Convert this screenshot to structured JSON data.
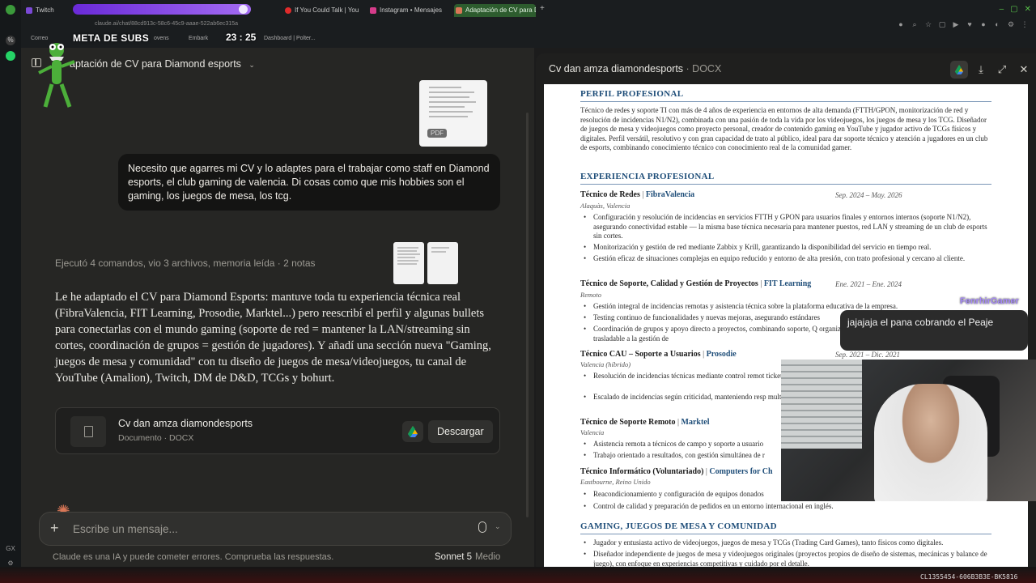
{
  "browser": {
    "tabs": [
      {
        "label": "Twitch"
      },
      {
        "label": "If You Could Talk | You"
      },
      {
        "label": "Instagram • Mensajes"
      },
      {
        "label": "Adaptación de CV para Dia"
      }
    ],
    "address": "claude.ai/chat/88cd913c-58c6-45c9-aaae-522ab6ec315a",
    "bookmarks": [
      "Correo",
      "ovens",
      "Embark",
      "Dashboard | Polter..."
    ],
    "accent_color": "#2d5c2e"
  },
  "overlay": {
    "subs_title": "META DE SUBS",
    "subs_count": "23 : 25",
    "bar_color": "#8a4ae6"
  },
  "chat": {
    "conversation_title": "aptación de CV para Diamond esports",
    "pdf_badge": "PDF",
    "user_message": "Necesito que agarres mi CV y lo adaptes para el trabajar como staff en Diamond esports, el club gaming de valencia. Di cosas como que mis hobbies son el gaming, los juegos de mesa, los tcg.",
    "activity": "Ejecutó 4 comandos, vio 3 archivos, memoria leída · 2 notas",
    "assistant_message": "Le he adaptado el CV para Diamond Esports: mantuve toda tu experiencia técnica real (FibraValencia, FIT Learning, Prosodie, Marktel...) pero reescribí el perfil y algunas bullets para conectarlas con el mundo gaming (soporte de red = mantener la LAN/streaming sin cortes, coordinación de grupos = gestión de jugadores). Y añadí una sección nueva \"Gaming, juegos de mesa y comunidad\" con tu diseño de juegos de mesa/videojuegos, tu canal de YouTube (Amalion), Twitch, DM de D&D, TCGs y bohurt.",
    "file": {
      "name": "Cv dan amza diamondesports",
      "meta": "Documento · DOCX",
      "download_label": "Descargar"
    },
    "composer": {
      "placeholder": "Escribe un mensaje..."
    },
    "disclaimer": "Claude es una IA y puede cometer errores. Comprueba las respuestas.",
    "model": "Sonnet 5",
    "level": "Medio"
  },
  "doc": {
    "title": "Cv dan amza diamondesports",
    "type": "· DOCX",
    "profile_heading": "PERFIL PROFESIONAL",
    "profile_text": "Técnico de redes y soporte TI con más de 4 años de experiencia en entornos de alta demanda (FTTH/GPON, monitorización de red y resolución de incidencias N1/N2), combinada con una pasión de toda la vida por los videojuegos, los juegos de mesa y los TCG. Diseñador de juegos de mesa y videojuegos como proyecto personal, creador de contenido gaming en YouTube y jugador activo de TCGs físicos y digitales. Perfil versátil, resolutivo y con gran capacidad de trato al público, ideal para dar soporte técnico y atención a jugadores en un club de esports, combinando conocimiento técnico con conocimiento real de la comunidad gamer.",
    "exp_heading": "EXPERIENCIA PROFESIONAL",
    "jobs": [
      {
        "role": "Técnico de Redes",
        "company": "FibraValencia",
        "dates": "Sep. 2024 – May. 2026",
        "location": "Alaquàs, Valencia",
        "bullets": [
          "Configuración y resolución de incidencias en servicios FTTH y GPON para usuarios finales y entornos internos (soporte N1/N2), asegurando conectividad estable — la misma base técnica necesaria para mantener puestos, red LAN y streaming de un club de esports sin cortes.",
          "Monitorización y gestión de red mediante Zabbix y Krill, garantizando la disponibilidad del servicio en tiempo real.",
          "Gestión eficaz de situaciones complejas en equipo reducido y entorno de alta presión, con trato profesional y cercano al cliente."
        ]
      },
      {
        "role": "Técnico de Soporte, Calidad y Gestión de Proyectos",
        "company": "FIT Learning",
        "dates": "Ene. 2021 – Ene. 2024",
        "location": "Remoto",
        "bullets": [
          "Gestión integral de incidencias remotas y asistencia técnica sobre la plataforma educativa de la empresa.",
          "Testing continuo de funcionalidades y nuevas mejoras, asegurando estándares",
          "Coordinación de grupos y apoyo directo a proyectos, combinando soporte, Q organizando y acompañando a grupos de usuarios, trasladable a la gestión de"
        ]
      },
      {
        "role": "Técnico CAU – Soporte a Usuarios",
        "company": "Prosodie",
        "dates": "Sep. 2021 – Dic. 2021",
        "location": "Valencia (híbrido)",
        "bullets": [
          "Resolución de incidencias técnicas mediante control remot tickets.",
          "Escalado de incidencias según criticidad, manteniendo resp multidepartamental."
        ]
      },
      {
        "role": "Técnico de Soporte Remoto",
        "company": "Marktel",
        "dates": "",
        "location": "Valencia",
        "bullets": [
          "Asistencia remota a técnicos de campo y soporte a usuario",
          "Trabajo orientado a resultados, con gestión simultánea de r"
        ]
      },
      {
        "role": "Técnico Informático (Voluntariado)",
        "company": "Computers for Ch",
        "dates": "",
        "location": "Eastbourne, Reino Unido",
        "bullets": [
          "Reacondicionamiento y configuración de equipos donados",
          "Control de calidad y preparación de pedidos en un entorno internacional en inglés."
        ]
      }
    ],
    "gaming_heading": "GAMING, JUEGOS DE MESA Y COMUNIDAD",
    "gaming_bullets": [
      "Jugador y entusiasta activo de videojuegos, juegos de mesa y TCGs (Trading Card Games), tanto físicos como digitales.",
      "Diseñador independiente de juegos de mesa y videojuegos originales (proyectos propios de diseño de sistemas, mecánicas y balance de juego), con enfoque en experiencias competitivas y cuidado por el detalle."
    ]
  },
  "stream": {
    "chat_user": "FenrhirGamer",
    "chat_message": "jajajaja el pana cobrando el Peaje",
    "code": "CL1355454-606B3B3E-BK5816"
  }
}
